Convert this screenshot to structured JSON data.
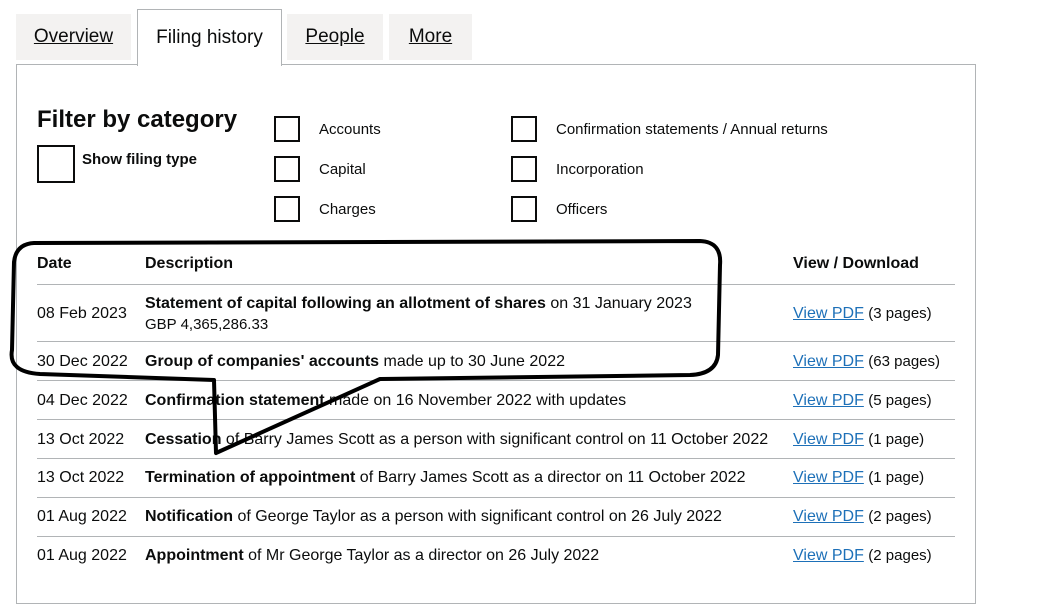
{
  "tabs": [
    {
      "label": "Overview"
    },
    {
      "label": "Filing history"
    },
    {
      "label": "People"
    },
    {
      "label": "More"
    }
  ],
  "filter": {
    "title": "Filter by category",
    "show_filing_type": "Show filing type",
    "categories": [
      "Accounts",
      "Capital",
      "Charges",
      "Confirmation statements / Annual returns",
      "Incorporation",
      "Officers"
    ]
  },
  "table": {
    "headers": {
      "date": "Date",
      "description": "Description",
      "view": "View / Download"
    },
    "link_label": "View PDF",
    "rows": [
      {
        "date": "08 Feb 2023",
        "bold": "Statement of capital following an allotment of shares",
        "rest": " on 31 January 2023",
        "sub": "GBP 4,365,286.33",
        "pages": "(3 pages)"
      },
      {
        "date": "30 Dec 2022",
        "bold": "Group of companies' accounts",
        "rest": " made up to 30 June 2022",
        "pages": "(63 pages)"
      },
      {
        "date": "04 Dec 2022",
        "bold": "Confirmation statement",
        "rest": " made on 16 November 2022 with updates",
        "pages": "(5 pages)"
      },
      {
        "date": "13 Oct 2022",
        "bold": "Cessation",
        "rest": " of Barry James Scott as a person with significant control on 11 October 2022",
        "pages": "(1 page)"
      },
      {
        "date": "13 Oct 2022",
        "bold": "Termination of appointment",
        "rest": " of Barry James Scott as a director on 11 October 2022",
        "pages": "(1 page)"
      },
      {
        "date": "01 Aug 2022",
        "bold": "Notification",
        "rest": " of George Taylor as a person with significant control on 26 July 2022",
        "pages": "(2 pages)"
      },
      {
        "date": "01 Aug 2022",
        "bold": "Appointment",
        "rest": " of Mr George Taylor as a director on 26 July 2022",
        "pages": "(2 pages)"
      }
    ]
  },
  "colors": {
    "link": "#1d70b8",
    "tab_bg": "#f3f2f1",
    "border": "#b1b4b6",
    "text": "#0b0c0c"
  }
}
